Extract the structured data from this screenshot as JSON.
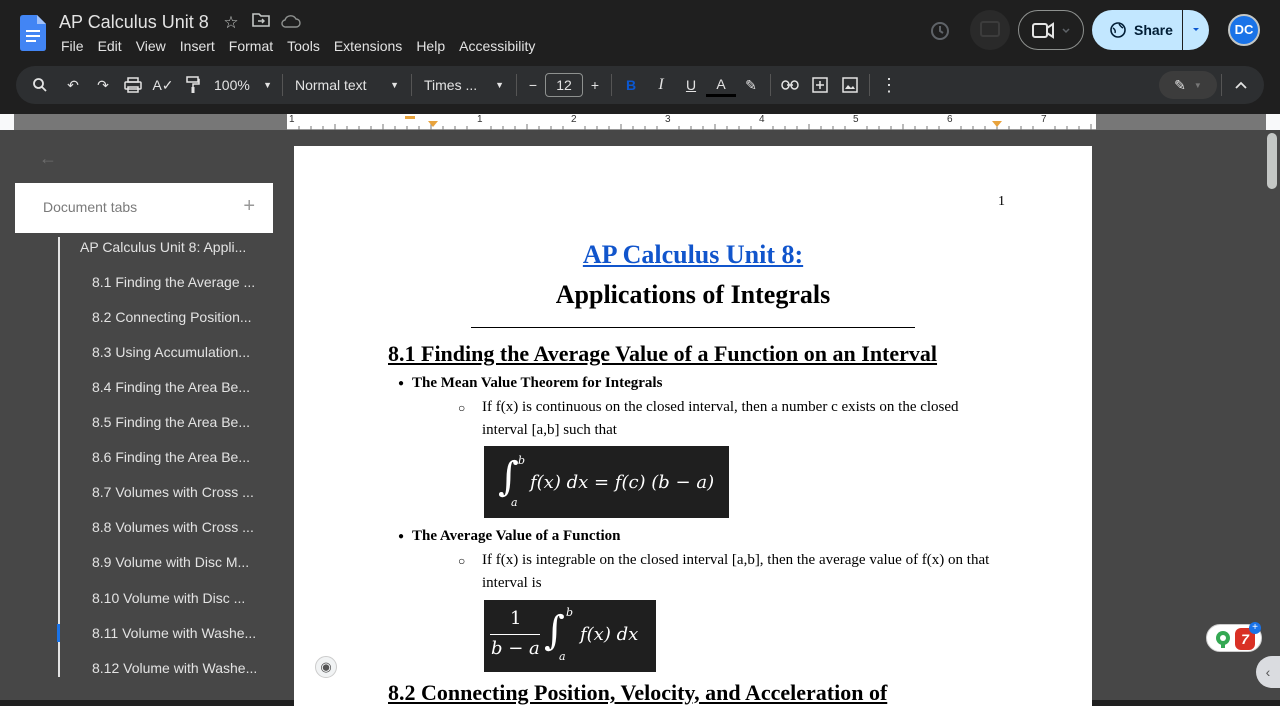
{
  "app": {
    "title": "AP Calculus Unit 8",
    "menu": [
      "File",
      "Edit",
      "View",
      "Insert",
      "Format",
      "Tools",
      "Extensions",
      "Help",
      "Accessibility"
    ],
    "share_label": "Share",
    "avatar_initials": "DC",
    "accent": "#c2e7ff"
  },
  "toolbar": {
    "zoom": "100%",
    "style": "Normal text",
    "font": "Times ...",
    "font_size": "12",
    "bold": "B",
    "italic": "I",
    "underline": "U",
    "text_color": "A"
  },
  "ruler": {
    "marks": [
      "1",
      "1",
      "2",
      "3",
      "4",
      "5",
      "6",
      "7"
    ]
  },
  "sidebar": {
    "header": "Document tabs",
    "add": "+",
    "items": [
      "AP Calculus Unit 8: Appli...",
      "8.1 Finding the Average ...",
      "8.2 Connecting Position...",
      "8.3 Using Accumulation...",
      "8.4 Finding the Area Be...",
      "8.5 Finding the Area Be...",
      "8.6 Finding the Area Be...",
      "8.7 Volumes with Cross ...",
      "8.8 Volumes with Cross ...",
      "8.9 Volume with Disc M...",
      "8.10 Volume with Disc ...",
      "8.11 Volume with Washe...",
      "8.12 Volume with Washe..."
    ]
  },
  "doc": {
    "page_number": "1",
    "title_line1": "AP Calculus Unit 8:",
    "title_line2": "Applications of Integrals",
    "section1_heading": "8.1 Finding the Average Value of a Function on an Interval",
    "bullet1": "The Mean Value Theorem for Integrals",
    "bullet1_text": "If f(x) is continuous on the closed interval, then a number c exists on the closed interval [a,b] such that",
    "eq1": {
      "upper": "b",
      "lower": "a",
      "body": "f(x) dx = f(c) (b − a)"
    },
    "bullet2": "The Average Value of a Function",
    "bullet2_text": "If f(x) is integrable on the closed interval [a,b], then the average value of f(x) on that interval is",
    "eq2": {
      "numerator": "1",
      "denominator": "b − a",
      "upper": "b",
      "lower": "a",
      "body": "f(x) dx"
    },
    "section2_heading": "8.2 Connecting Position, Velocity, and Acceleration of"
  },
  "extension_badge": "7"
}
